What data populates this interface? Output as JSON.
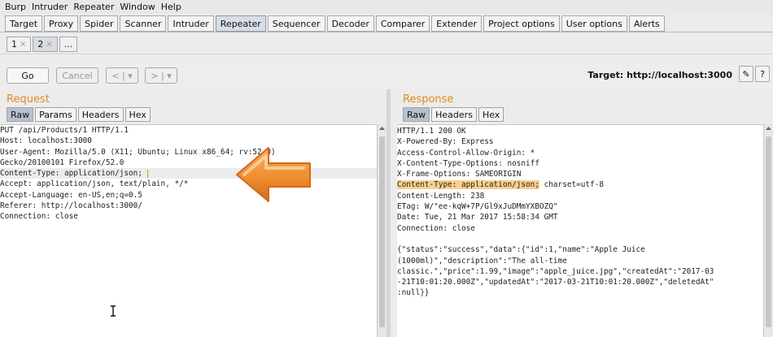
{
  "menu": [
    "Burp",
    "Intruder",
    "Repeater",
    "Window",
    "Help"
  ],
  "tabs": [
    "Target",
    "Proxy",
    "Spider",
    "Scanner",
    "Intruder",
    "Repeater",
    "Sequencer",
    "Decoder",
    "Comparer",
    "Extender",
    "Project options",
    "User options",
    "Alerts"
  ],
  "active_tab_index": 5,
  "repeater_tabs": [
    {
      "label": "1",
      "close": "×"
    },
    {
      "label": "2",
      "close": "×"
    },
    {
      "label": "..."
    }
  ],
  "active_repeater_tab_index": 1,
  "controls": {
    "go": "Go",
    "cancel": "Cancel",
    "back": "<",
    "back_menu": "▾",
    "forward": ">",
    "forward_menu": "▾",
    "target": "Target: http://localhost:3000",
    "edit_icon": "✎",
    "help_icon": "?"
  },
  "request": {
    "title": "Request",
    "tabs": [
      "Raw",
      "Params",
      "Headers",
      "Hex"
    ],
    "active_tab": "Raw",
    "lines": [
      "PUT /api/Products/1 HTTP/1.1",
      "Host: localhost:3000",
      "User-Agent: Mozilla/5.0 (X11; Ubuntu; Linux x86_64; rv:52.0)",
      "Gecko/20100101 Firefox/52.0",
      "Content-Type: application/json; ",
      "Accept: application/json, text/plain, */*",
      "Accept-Language: en-US,en;q=0.5",
      "Referer: http://localhost:3000/",
      "Connection: close"
    ],
    "highlight_line_index": 4
  },
  "response": {
    "title": "Response",
    "tabs": [
      "Raw",
      "Headers",
      "Hex"
    ],
    "active_tab": "Raw",
    "lines": [
      "HTTP/1.1 200 OK",
      "X-Powered-By: Express",
      "Access-Control-Allow-Origin: *",
      "X-Content-Type-Options: nosniff",
      "X-Frame-Options: SAMEORIGIN",
      "",
      "Content-Length: 238",
      "ETag: W/\"ee-kqW+7P/Gl9xJuDMmYXBOZQ\"",
      "Date: Tue, 21 Mar 2017 15:58:34 GMT",
      "Connection: close",
      "",
      "{\"status\":\"success\",\"data\":{\"id\":1,\"name\":\"Apple Juice",
      "(1000ml)\",\"description\":\"The all-time",
      "classic.\",\"price\":1.99,\"image\":\"apple_juice.jpg\",\"createdAt\":\"2017-03",
      "-21T10:01:20.000Z\",\"updatedAt\":\"2017-03-21T10:01:20.000Z\",\"deletedAt\"",
      ":null}}"
    ],
    "highlight_line_index": 5,
    "highlight_text": "Content-Type: application/json;",
    "highlight_suffix": " charset=utf-8"
  }
}
